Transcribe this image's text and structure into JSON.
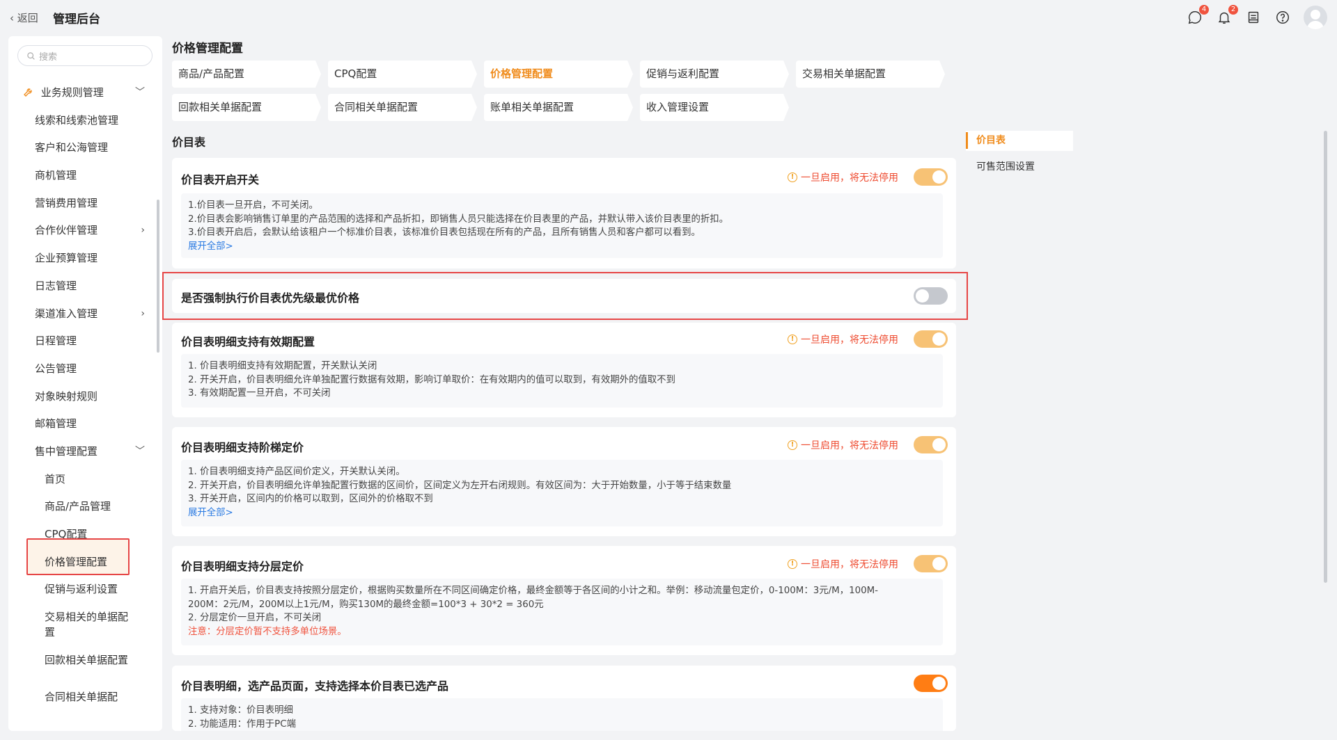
{
  "header": {
    "back_label": "返回",
    "title": "管理后台",
    "icons": [
      {
        "name": "chat-icon",
        "badge": "4"
      },
      {
        "name": "bell-icon",
        "badge": "2"
      },
      {
        "name": "inbox-icon",
        "badge": ""
      },
      {
        "name": "help-icon",
        "badge": ""
      }
    ]
  },
  "sidebar": {
    "search_placeholder": "搜索",
    "group_label": "业务规则管理",
    "items": [
      "线索和线索池管理",
      "客户和公海管理",
      "商机管理",
      "营销费用管理",
      "合作伙伴管理",
      "企业预算管理",
      "日志管理",
      "渠道准入管理",
      "日程管理",
      "公告管理",
      "对象映射规则",
      "邮箱管理",
      "售中管理配置"
    ],
    "sub_items": [
      "首页",
      "商品/产品管理",
      "CPQ配置",
      "价格管理配置",
      "促销与返利设置",
      "交易相关的单据配置",
      "回款相关单据配置",
      "合同相关单据配"
    ],
    "active_item": "价格管理配置"
  },
  "main": {
    "title": "价格管理配置",
    "tabs": [
      "商品/产品配置",
      "CPQ配置",
      "价格管理配置",
      "促销与返利配置",
      "交易相关单据配置",
      "回款相关单据配置",
      "合同相关单据配置",
      "账单相关单据配置",
      "收入管理设置"
    ],
    "active_tab": "价格管理配置",
    "section_title": "价目表",
    "cards": [
      {
        "title": "价目表开启开关",
        "warning": "一旦启用，将无法停用",
        "toggle_state": "on-disabled",
        "lines": [
          "1.价目表一旦开启，不可关闭。",
          "2.价目表会影响销售订单里的产品范围的选择和产品折扣，即销售人员只能选择在价目表里的产品，并默认带入该价目表里的折扣。",
          "3.价目表开启后，会默认给该租户一个标准价目表，该标准价目表包括现在所有的产品，且所有销售人员和客户都可以看到。"
        ],
        "link": "展开全部>"
      },
      {
        "title": "是否强制执行价目表优先级最优价格",
        "warning": "",
        "toggle_state": "off",
        "lines": []
      },
      {
        "title": "价目表明细支持有效期配置",
        "warning": "一旦启用，将无法停用",
        "toggle_state": "on-disabled",
        "lines": [
          "1. 价目表明细支持有效期配置，开关默认关闭",
          "2. 开关开启，价目表明细允许单独配置行数据有效期，影响订单取价：在有效期内的值可以取到，有效期外的值取不到",
          "3. 有效期配置一旦开启，不可关闭"
        ]
      },
      {
        "title": "价目表明细支持阶梯定价",
        "warning": "一旦启用，将无法停用",
        "toggle_state": "on-disabled",
        "lines": [
          "1. 价目表明细支持产品区间价定义，开关默认关闭。",
          "2. 开关开启，价目表明细允许单独配置行数据的区间价，区间定义为左开右闭规则。有效区间为：大于开始数量，小于等于结束数量",
          "3. 开关开启，区间内的价格可以取到，区间外的价格取不到"
        ],
        "link": "展开全部>"
      },
      {
        "title": "价目表明细支持分层定价",
        "warning": "一旦启用，将无法停用",
        "toggle_state": "on-disabled",
        "lines": [
          "1. 开启开关后，价目表支持按照分层定价，根据购买数量所在不同区间确定价格，最终金额等于各区间的小计之和。举例：移动流量包定价，0-100M：3元/M，100M-",
          "200M：2元/M，200M以上1元/M，购买130M的最终金额=100*3 + 30*2 = 360元",
          "2. 分层定价一旦开启，不可关闭"
        ],
        "note": "注意：分层定价暂不支持多单位场景。"
      },
      {
        "title": "价目表明细，选产品页面，支持选择本价目表已选产品",
        "warning": "",
        "toggle_state": "on",
        "lines": [
          "1. 支持对象：价目表明细",
          "2. 功能适用：作用于PC端"
        ]
      }
    ]
  },
  "anchor": {
    "items": [
      "价目表",
      "可售范围设置"
    ],
    "active": "价目表"
  },
  "colors": {
    "accent": "#f08c1c",
    "toggle_on": "#ff7d14",
    "toggle_on_disabled": "#f7c275",
    "warning_text": "#ee4a2f",
    "highlight_border": "#e64545",
    "link": "#2a7ae2"
  }
}
